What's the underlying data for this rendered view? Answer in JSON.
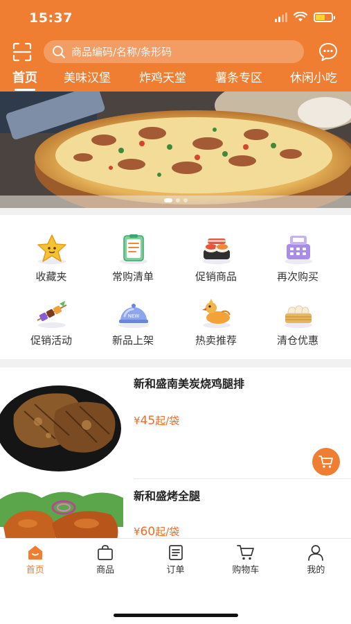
{
  "status_bar": {
    "time": "15:37"
  },
  "search": {
    "placeholder": "商品编码/名称/条形码"
  },
  "tabs": [
    {
      "label": "首页",
      "active": true
    },
    {
      "label": "美味汉堡",
      "active": false
    },
    {
      "label": "炸鸡天堂",
      "active": false
    },
    {
      "label": "薯条专区",
      "active": false
    },
    {
      "label": "休闲小吃",
      "active": false
    }
  ],
  "banner": {
    "subject": "pizza"
  },
  "categories": [
    {
      "label": "收藏夹",
      "icon": "star-icon"
    },
    {
      "label": "常购清单",
      "icon": "clipboard-list-icon"
    },
    {
      "label": "促销商品",
      "icon": "sushi-icon"
    },
    {
      "label": "再次购买",
      "icon": "cash-register-icon"
    },
    {
      "label": "促销活动",
      "icon": "skewer-icon"
    },
    {
      "label": "新品上架",
      "icon": "new-cloche-icon"
    },
    {
      "label": "热卖推荐",
      "icon": "duck-icon"
    },
    {
      "label": "清仓优惠",
      "icon": "dim-sum-icon"
    }
  ],
  "products": [
    {
      "name": "新和盛南美炭烧鸡腿排",
      "currency": "¥",
      "price": "45",
      "unit": "起/袋"
    },
    {
      "name": "新和盛烤全腿",
      "currency": "¥",
      "price": "60",
      "unit": "起/袋"
    }
  ],
  "bottom_nav": [
    {
      "label": "首页",
      "icon": "home-icon",
      "active": true
    },
    {
      "label": "商品",
      "icon": "bag-icon",
      "active": false
    },
    {
      "label": "订单",
      "icon": "order-icon",
      "active": false
    },
    {
      "label": "购物车",
      "icon": "cart-icon",
      "active": false
    },
    {
      "label": "我的",
      "icon": "user-icon",
      "active": false
    }
  ],
  "colors": {
    "accent": "#ef7d32",
    "price": "#ef6c27"
  }
}
